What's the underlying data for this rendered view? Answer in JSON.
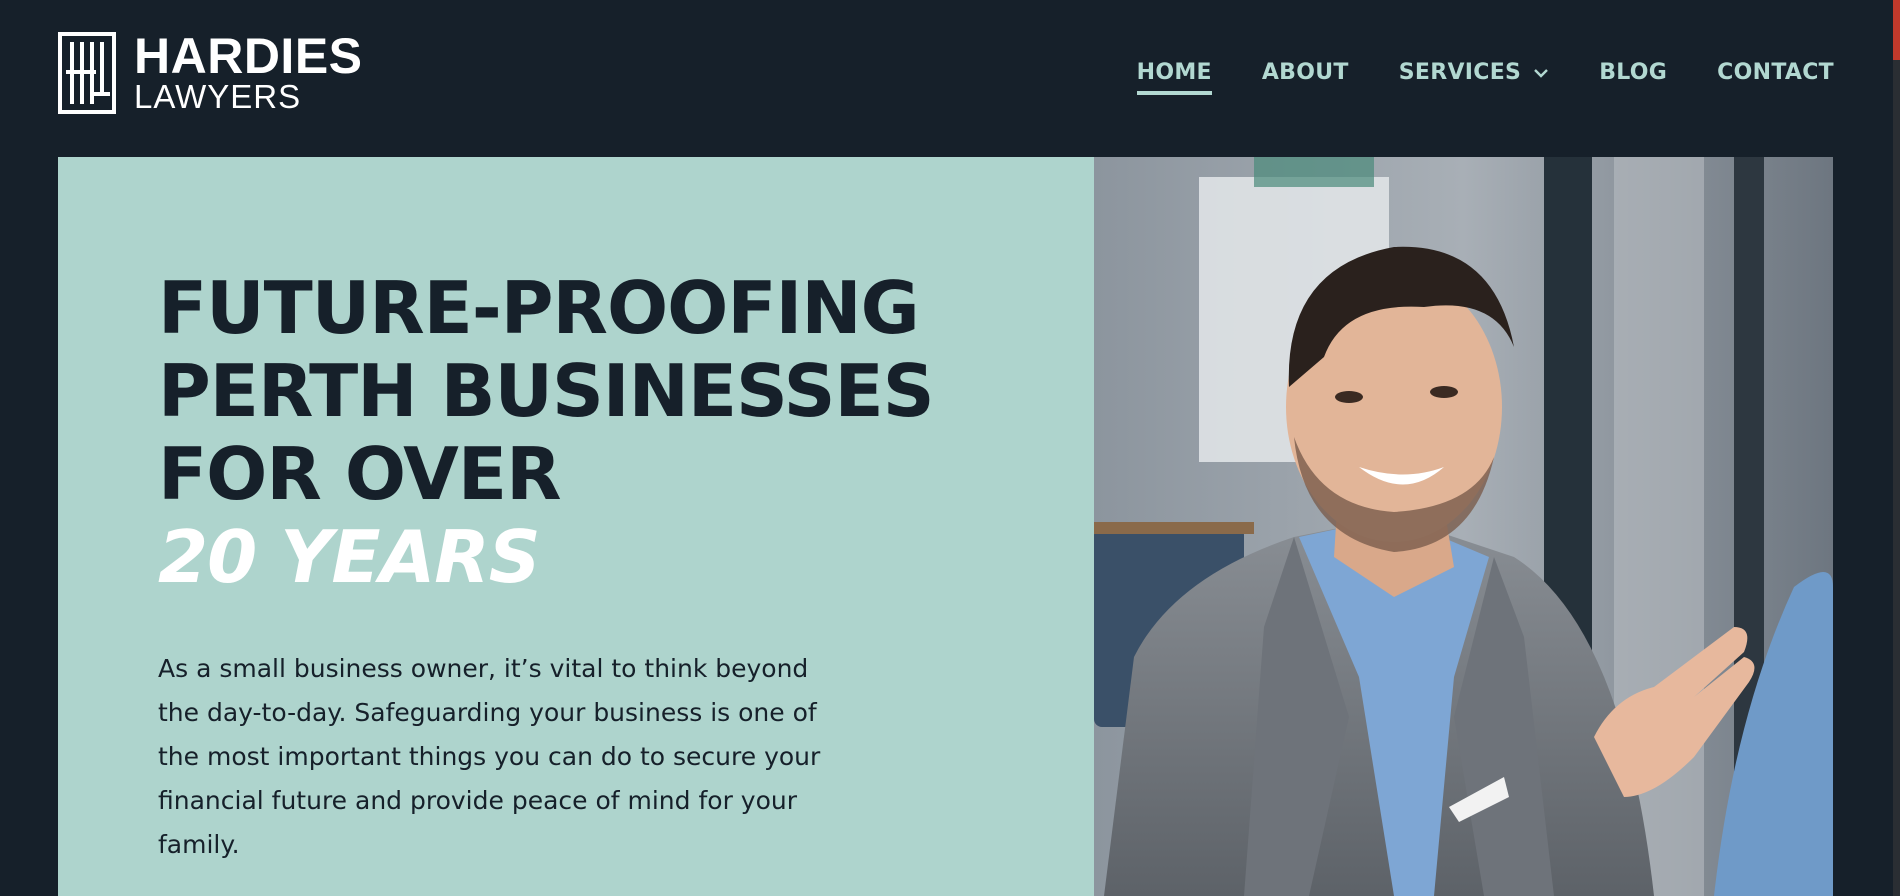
{
  "brand": {
    "line1": "HARDIES",
    "line2": "LAWYERS"
  },
  "nav": {
    "items": [
      {
        "label": "HOME",
        "active": true
      },
      {
        "label": "ABOUT",
        "active": false
      },
      {
        "label": "SERVICES",
        "active": false,
        "has_dropdown": true
      },
      {
        "label": "BLOG",
        "active": false
      },
      {
        "label": "CONTACT",
        "active": false
      }
    ]
  },
  "hero": {
    "title_lines": [
      "FUTURE-PROOFING",
      "PERTH BUSINESSES",
      "FOR OVER"
    ],
    "title_accent": "20 YEARS",
    "body": "As a small business owner, it’s vital to think beyond the day-to-day. Safeguarding your business is one of the most important things you can do to secure your financial future and provide peace of mind for your family."
  },
  "colors": {
    "background": "#16202a",
    "panel": "#aed4cd",
    "nav_text": "#b2d8d1",
    "accent_text": "#ffffff"
  }
}
